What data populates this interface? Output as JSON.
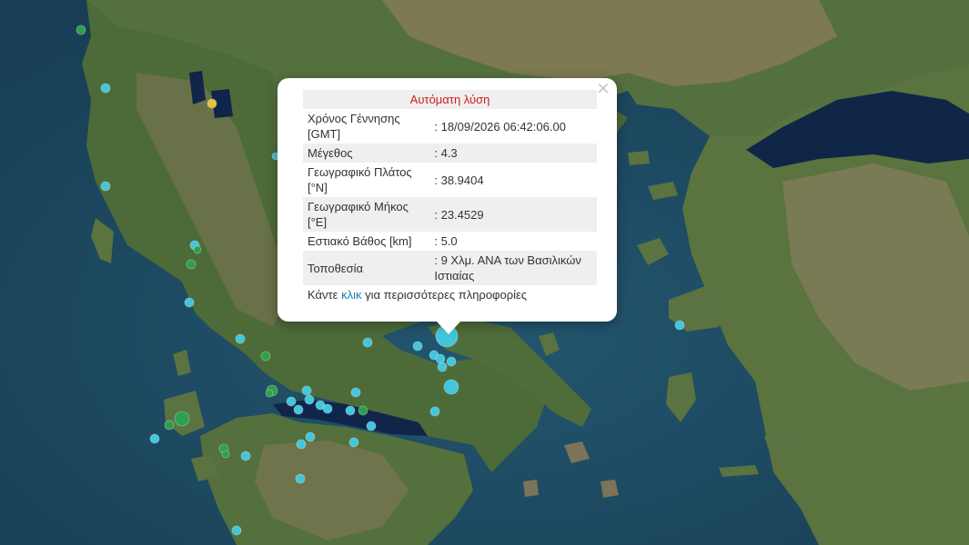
{
  "popup": {
    "title": "Αυτόματη λύση",
    "close_symbol": "×",
    "rows": [
      {
        "label": "Χρόνος Γέννησης [GMT]",
        "value": ": 18/09/2026 06:42:06.00"
      },
      {
        "label": "Μέγεθος",
        "value": ": 4.3"
      },
      {
        "label": "Γεωγραφικό Πλάτος [°N]",
        "value": ": 38.9404"
      },
      {
        "label": "Γεωγραφικό Μήκος [°E]",
        "value": ": 23.4529"
      },
      {
        "label": "Εστιακό Βάθος [km]",
        "value": ": 5.0"
      },
      {
        "label": "Τοποθεσία",
        "value": ": 9 Χλμ. ΑΝΑ των Βασιλικών Ιστιαίας"
      }
    ],
    "more": {
      "prefix": "Κάντε ",
      "link": "κλικ",
      "suffix": " για περισσότερες πληροφορίες"
    }
  },
  "marker_colors": {
    "cyan": "#43c6dc",
    "green": "#2ea04d",
    "yellow": "#e3c23a"
  },
  "map_colors": {
    "sea": "#1f4d66",
    "sea_deep": "#183f57",
    "land": "#4c6a3a",
    "land_dry": "#8a7f5e",
    "lake": "#10254a"
  }
}
